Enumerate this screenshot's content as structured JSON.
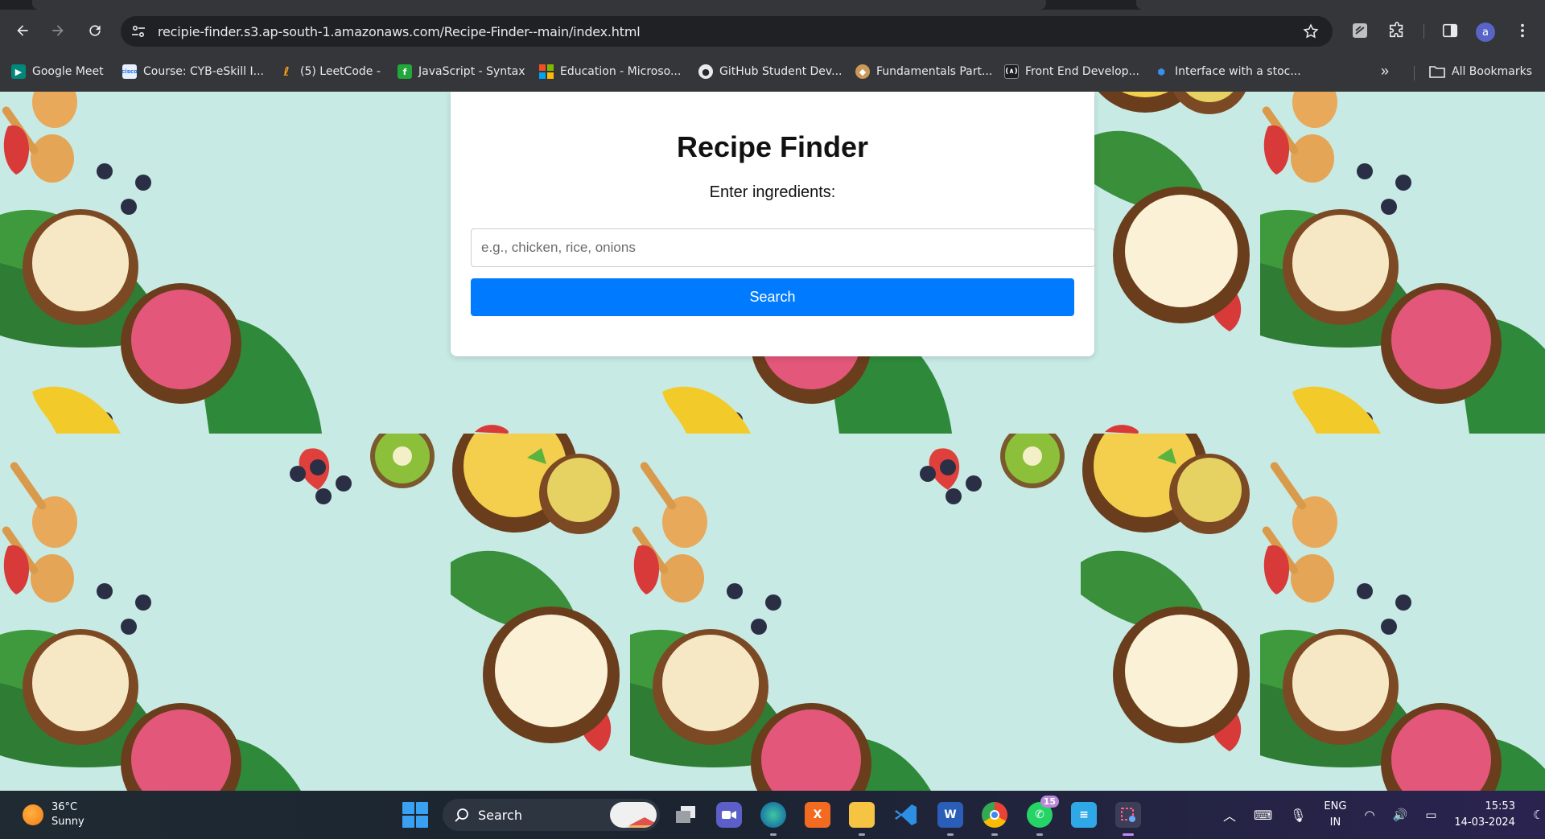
{
  "browser": {
    "url": "recipie-finder.s3.ap-south-1.amazonaws.com/Recipe-Finder--main/index.html",
    "profile_initial": "a",
    "bookmarks": [
      {
        "label": "Google Meet",
        "icon": "google-meet-icon",
        "color": "#00897b"
      },
      {
        "label": "Course: CYB-eSkill I...",
        "icon": "cisco-icon",
        "color": "#e8f0fe"
      },
      {
        "label": "(5) LeetCode -",
        "icon": "leetcode-icon",
        "color": "#ffa116"
      },
      {
        "label": "JavaScript - Syntax",
        "icon": "javascript-icon",
        "color": "#22a83a"
      },
      {
        "label": "Education - Microso...",
        "icon": "microsoft-icon",
        "color": "#f25022"
      },
      {
        "label": "GitHub Student Dev...",
        "icon": "github-icon",
        "color": "#24292e"
      },
      {
        "label": "Fundamentals Part...",
        "icon": "bookmark-favicon-icon",
        "color": "#c89a5a"
      },
      {
        "label": "Front End Develop...",
        "icon": "meta-icon",
        "color": "#1c1e21"
      },
      {
        "label": "Interface with a stoc...",
        "icon": "web-icon",
        "color": "#1565c0"
      }
    ],
    "all_bookmarks_label": "All Bookmarks"
  },
  "page": {
    "title": "Recipe Finder",
    "ingredients_label": "Enter ingredients:",
    "input_placeholder": "e.g., chicken, rice, onions",
    "search_button": "Search",
    "accent_color": "#007bff"
  },
  "taskbar": {
    "weather_temp": "36°C",
    "weather_desc": "Sunny",
    "search_label": "Search",
    "whatsapp_badge": "15",
    "lang_top": "ENG",
    "lang_bottom": "IN",
    "time": "15:53",
    "date": "14-03-2024"
  }
}
